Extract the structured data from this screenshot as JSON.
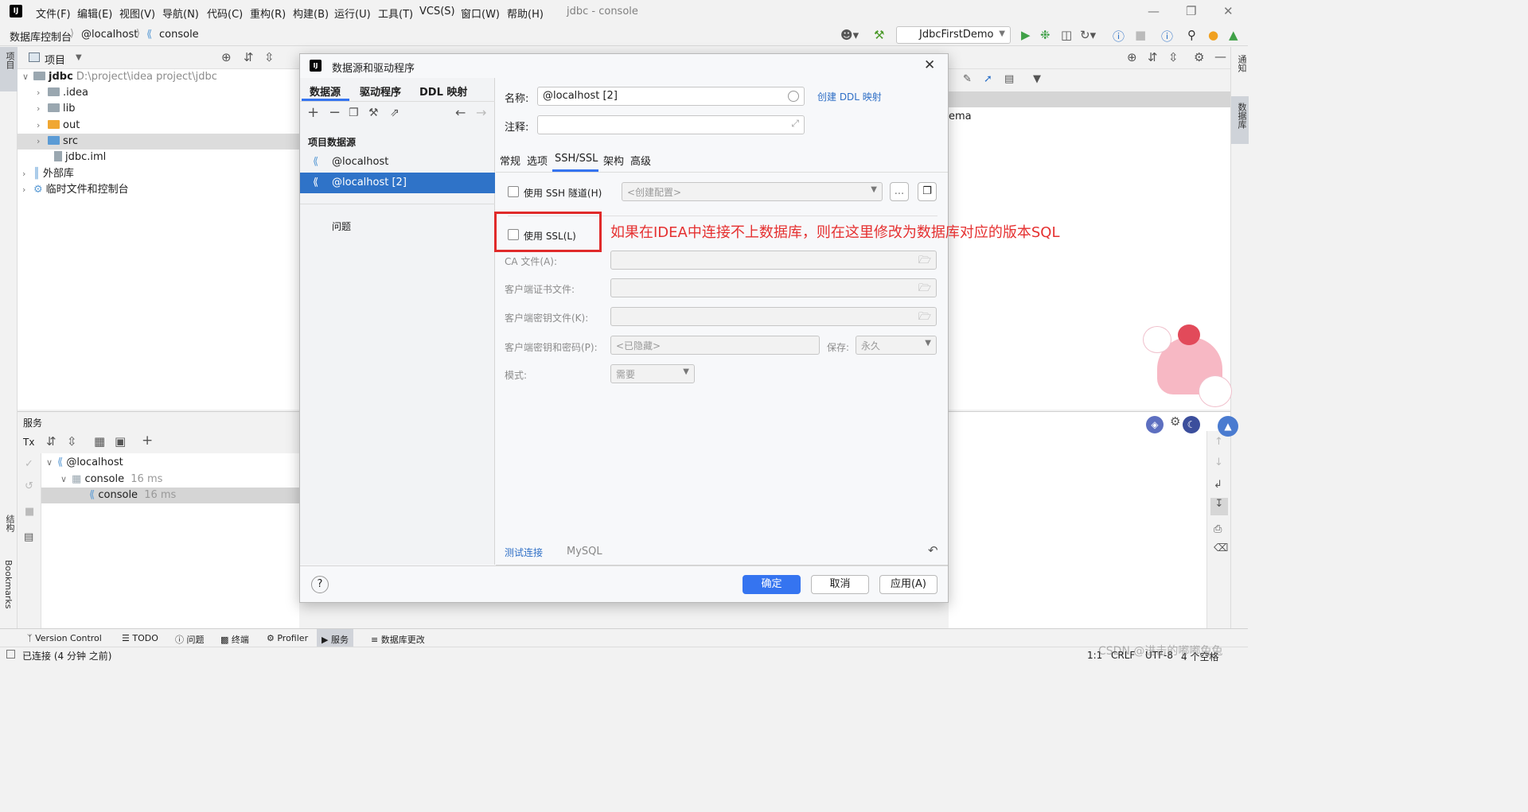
{
  "menu": {
    "items": [
      "文件(F)",
      "编辑(E)",
      "视图(V)",
      "导航(N)",
      "代码(C)",
      "重构(R)",
      "构建(B)",
      "运行(U)",
      "工具(T)",
      "VCS(S)",
      "窗口(W)",
      "帮助(H)"
    ],
    "window_title": "jdbc - console"
  },
  "nav": {
    "crumbs": [
      "数据库控制台",
      "@localhost",
      "console"
    ],
    "run_config": "JdbcFirstDemo"
  },
  "left_strip": {
    "project": "项目",
    "structure": "结构",
    "bookmarks": "Bookmarks"
  },
  "right_strip": {
    "notifications": "通知",
    "database": "数据库"
  },
  "project": {
    "header": "项目",
    "root_name": "jdbc",
    "root_path": "D:\\project\\idea project\\jdbc",
    "items": [
      ".idea",
      "lib",
      "out",
      "src",
      "jdbc.iml"
    ],
    "external": "外部库",
    "scratches": "临时文件和控制台"
  },
  "services": {
    "header": "服务",
    "tx": "Tx",
    "host": "@localhost",
    "console1": "console",
    "console1_time": "16 ms",
    "console2": "console",
    "console2_time": "16 ms"
  },
  "editor_peek": {
    "schema_text": "ema"
  },
  "dialog": {
    "title": "数据源和驱动程序",
    "tabs": [
      "数据源",
      "驱动程序",
      "DDL 映射"
    ],
    "section_title": "项目数据源",
    "sources": [
      "@localhost",
      "@localhost [2]"
    ],
    "problems": "问题",
    "name_label": "名称:",
    "name_value": "@localhost [2]",
    "create_ddl": "创建 DDL 映射",
    "comment_label": "注释:",
    "subtabs": [
      "常规",
      "选项",
      "SSH/SSL",
      "架构",
      "高级"
    ],
    "ssh_label": "使用 SSH 隧道(H)",
    "ssh_config_placeholder": "<创建配置>",
    "ssh_more": "...",
    "ssl_label": "使用 SSL(L)",
    "ca_label": "CA 文件(A):",
    "client_cert_label": "客户端证书文件:",
    "client_key_label": "客户端密钥文件(K):",
    "client_pass_label": "客户端密钥和密码(P):",
    "client_pass_value": "<已隐藏>",
    "save_label": "保存:",
    "save_value": "永久",
    "mode_label": "模式:",
    "mode_value": "需要",
    "test_connection": "测试连接",
    "driver_name": "MySQL",
    "ok": "确定",
    "cancel": "取消",
    "apply": "应用(A)"
  },
  "annotation": "如果在IDEA中连接不上数据库，则在这里修改为数据库对应的版本SQL",
  "toolwindows": [
    "Version Control",
    "TODO",
    "问题",
    "终端",
    "Profiler",
    "服务",
    "数据库更改"
  ],
  "status": {
    "connected": "已连接 (4 分钟 之前)",
    "position": "1:1",
    "line_sep": "CRLF",
    "encoding": "UTF-8",
    "indent": "4 个空格",
    "watermark": "CSDN @进击的嘟嘟兔兔"
  },
  "colors": {
    "accent": "#3574f0",
    "selection": "#2f73c8",
    "annotation": "#e53030",
    "link": "#2f6fc6"
  }
}
